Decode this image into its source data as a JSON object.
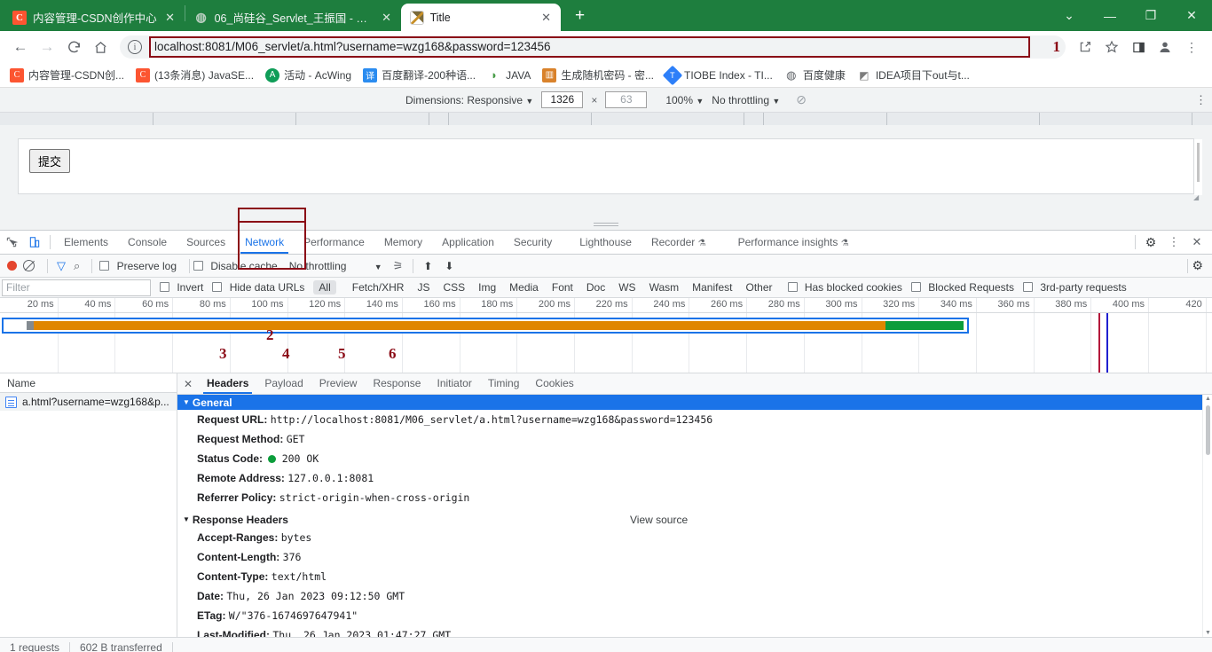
{
  "window": {
    "controls": [
      "chevron-down",
      "minimize",
      "restore",
      "close"
    ]
  },
  "tabs": [
    {
      "title": "内容管理-CSDN创作中心",
      "icon": "csdn-favicon",
      "active": false
    },
    {
      "title": "06_尚硅谷_Servlet_王振国 - 课堂",
      "icon": "globe-favicon",
      "active": false
    },
    {
      "title": "Title",
      "icon": "image-favicon",
      "active": true
    }
  ],
  "newtab_label": "+",
  "toolbar": {
    "back": "←",
    "forward": "→",
    "reload": "C",
    "home": "⌂",
    "url": "localhost:8081/M06_servlet/a.html?username=wzg168&password=123456",
    "share_icon": "share-icon",
    "bookmark_icon": "star-icon",
    "sidepanel_icon": "side-panel-icon",
    "profile_icon": "profile-icon",
    "menu_icon": "kebab-menu-icon"
  },
  "annotations": [
    {
      "num": "1",
      "target": "address-bar"
    },
    {
      "num": "2",
      "target": "network-tab"
    },
    {
      "num": "3",
      "target": "headers-tab"
    },
    {
      "num": "4",
      "target": "payload-tab"
    },
    {
      "num": "5",
      "target": "preview-tab"
    },
    {
      "num": "6",
      "target": "response-tab"
    }
  ],
  "bookmarks": [
    {
      "label": "内容管理-CSDN创...",
      "icon": "csdn-icon",
      "color": "#fc5531"
    },
    {
      "label": "(13条消息) JavaSE...",
      "icon": "csdn-icon",
      "color": "#fc5531"
    },
    {
      "label": "活动 - AcWing",
      "icon": "acwing-icon",
      "color": "#0f9d58"
    },
    {
      "label": "百度翻译-200种语...",
      "icon": "translate-icon",
      "color": "#2b8cf0"
    },
    {
      "label": "JAVA",
      "icon": "java-icon",
      "color": "#4a9d4a"
    },
    {
      "label": "生成随机密码 - 密...",
      "icon": "password-icon",
      "color": "#d9822b"
    },
    {
      "label": "TIOBE Index - TI...",
      "icon": "tiobe-icon",
      "color": "#2d7ff9"
    },
    {
      "label": "百度健康",
      "icon": "baidu-icon",
      "color": "#5f6368"
    },
    {
      "label": "IDEA项目下out与t...",
      "icon": "idea-icon",
      "color": "#7d7d7d"
    }
  ],
  "device_toolbar": {
    "dimensions_label": "Dimensions: Responsive",
    "width": "1326",
    "height_placeholder": "63",
    "x_label": "×",
    "zoom": "100%",
    "throttling": "No throttling",
    "rotate_icon": "rotate-disabled-icon",
    "menu_icon": "kebab-menu-icon"
  },
  "page": {
    "submit_button": "提交"
  },
  "devtools": {
    "panels": [
      "Elements",
      "Console",
      "Sources",
      "Network",
      "Performance",
      "Memory",
      "Application",
      "Security",
      "Lighthouse",
      "Recorder",
      "Performance insights"
    ],
    "selected_panel": "Network",
    "experiment_panels": [
      "Recorder",
      "Performance insights"
    ],
    "inspect_icon": "inspect-element-icon",
    "device_icon": "device-toolbar-icon",
    "settings_icon": "gear-icon",
    "more_icon": "kebab-menu-icon",
    "close_icon": "close-icon",
    "network_toolbar": {
      "record_icon": "record-icon",
      "clear_icon": "clear-icon",
      "filter_icon": "funnel-icon",
      "search_icon": "search-icon",
      "preserve_log": "Preserve log",
      "disable_cache": "Disable cache",
      "throttling": "No throttling",
      "wifi_icon": "network-conditions-icon",
      "upload_icon": "upload-har-icon",
      "download_icon": "download-har-icon",
      "settings_icon": "gear-icon"
    },
    "filter_bar": {
      "filter_placeholder": "Filter",
      "invert": "Invert",
      "hide_data_urls": "Hide data URLs",
      "types": [
        "All",
        "Fetch/XHR",
        "JS",
        "CSS",
        "Img",
        "Media",
        "Font",
        "Doc",
        "WS",
        "Wasm",
        "Manifest",
        "Other"
      ],
      "selected_type": "All",
      "has_blocked_cookies": "Has blocked cookies",
      "blocked_requests": "Blocked Requests",
      "third_party_requests": "3rd-party requests"
    },
    "timeline_ticks": [
      "20 ms",
      "40 ms",
      "60 ms",
      "80 ms",
      "100 ms",
      "120 ms",
      "140 ms",
      "160 ms",
      "180 ms",
      "200 ms",
      "220 ms",
      "240 ms",
      "260 ms",
      "280 ms",
      "300 ms",
      "320 ms",
      "340 ms",
      "360 ms",
      "380 ms",
      "400 ms",
      "420"
    ],
    "request_list": {
      "column_header": "Name",
      "rows": [
        {
          "name": "a.html?username=wzg168&p...",
          "icon": "document-icon",
          "selected": true
        }
      ]
    },
    "detail_tabs": [
      "Headers",
      "Payload",
      "Preview",
      "Response",
      "Initiator",
      "Timing",
      "Cookies"
    ],
    "selected_detail_tab": "Headers",
    "sections": [
      {
        "title": "General",
        "highlighted": true,
        "rows": [
          {
            "name": "Request URL:",
            "value": "http://localhost:8081/M06_servlet/a.html?username=wzg168&password=123456"
          },
          {
            "name": "Request Method:",
            "value": "GET"
          },
          {
            "name": "Status Code:",
            "value": "200 OK",
            "status_dot": "#0c9d3b"
          },
          {
            "name": "Remote Address:",
            "value": "127.0.0.1:8081"
          },
          {
            "name": "Referrer Policy:",
            "value": "strict-origin-when-cross-origin"
          }
        ]
      },
      {
        "title": "Response Headers",
        "highlighted": false,
        "view_source": "View source",
        "rows": [
          {
            "name": "Accept-Ranges:",
            "value": "bytes"
          },
          {
            "name": "Content-Length:",
            "value": "376"
          },
          {
            "name": "Content-Type:",
            "value": "text/html"
          },
          {
            "name": "Date:",
            "value": "Thu, 26 Jan 2023 09:12:50 GMT"
          },
          {
            "name": "ETag:",
            "value": "W/\"376-1674697647941\""
          },
          {
            "name": "Last-Modified:",
            "value": "Thu, 26 Jan 2023 01:47:27 GMT"
          }
        ]
      }
    ],
    "status_bar": {
      "requests": "1 requests",
      "transferred": "602 B transferred"
    }
  },
  "colors": {
    "chrome_frame": "#1e7e3e",
    "accent_blue": "#1a73e8",
    "annotation_red": "#8b0a16",
    "status_green": "#0c9d3b",
    "waterfall_orange": "#e08600"
  }
}
